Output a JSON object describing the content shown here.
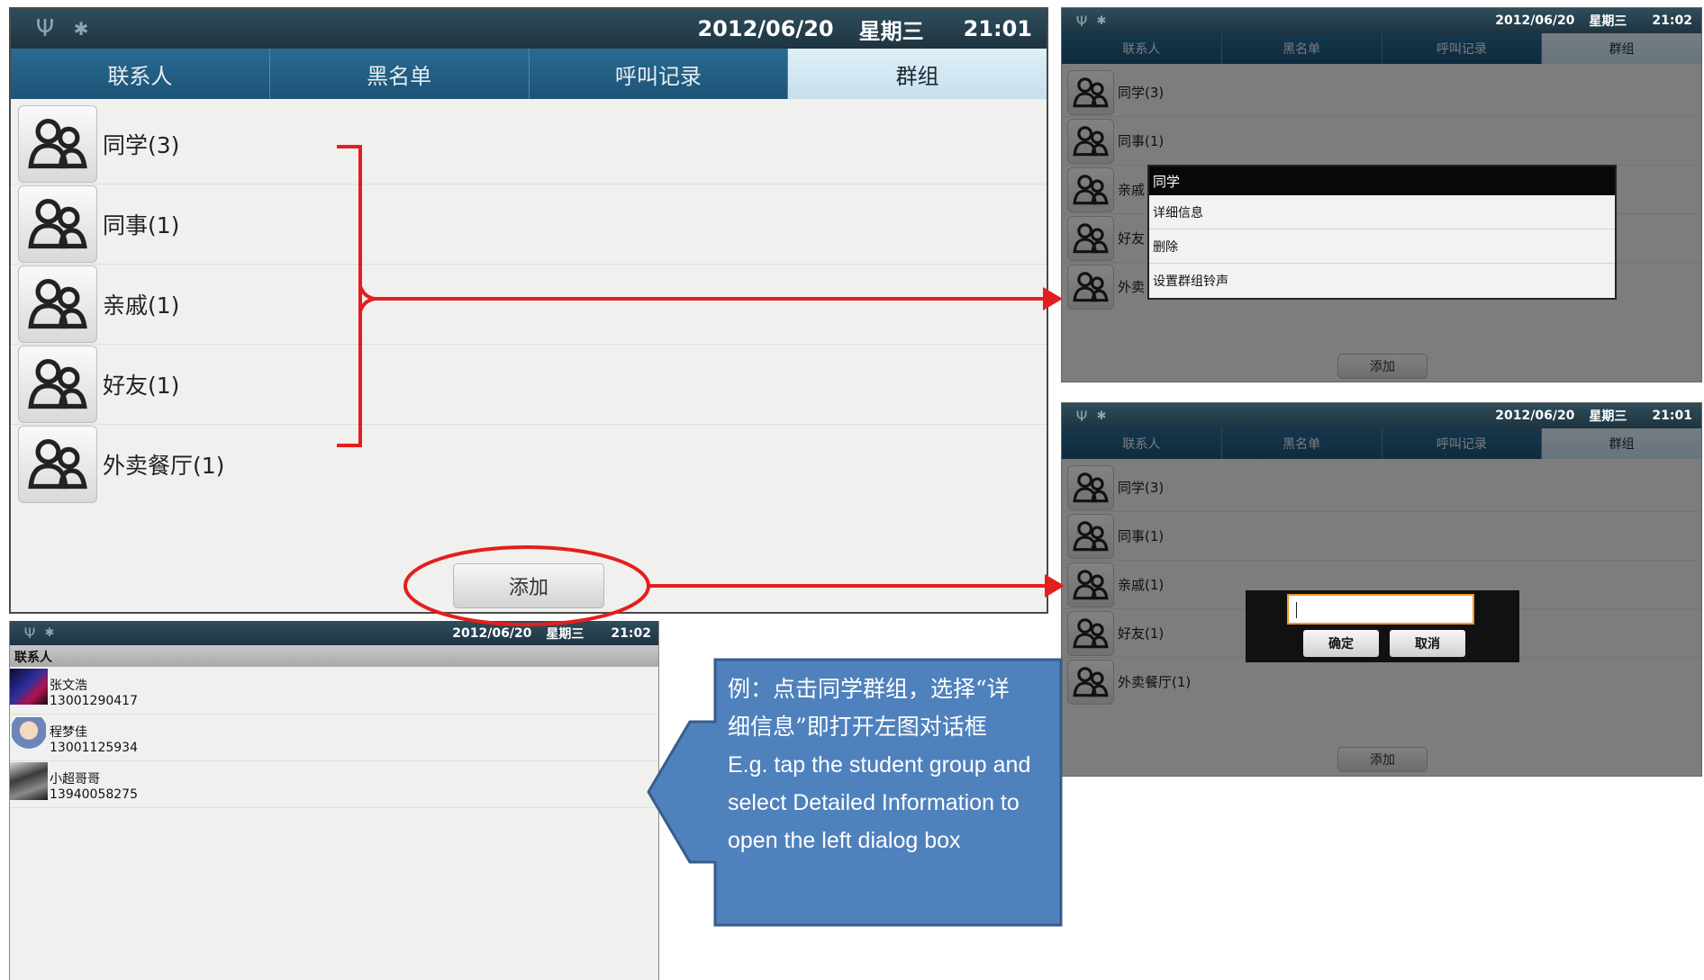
{
  "status": {
    "date": "2012/06/20",
    "weekday": "星期三",
    "time_main": "21:01",
    "time_menu": "21:02",
    "time_dialog": "21:01",
    "time_contacts": "21:02",
    "usb_icon": "usb-icon",
    "debug_icon": "android-debug-icon"
  },
  "tabs": [
    "联系人",
    "黑名单",
    "呼叫记录",
    "群组"
  ],
  "groups": [
    {
      "label": "同学(3)",
      "short": "同学(3)"
    },
    {
      "label": "同事(1)",
      "short": "同事(1)"
    },
    {
      "label": "亲戚(1)",
      "short": "亲戚"
    },
    {
      "label": "好友(1)",
      "short": "好友"
    },
    {
      "label": "外卖餐厅(1)",
      "short": "外卖"
    }
  ],
  "dialog_groups": [
    "同学(3)",
    "同事(1)",
    "亲戚(1)",
    "好友(1)",
    "外卖餐厅(1)"
  ],
  "add_button": "添加",
  "context_menu": {
    "title": "同学",
    "items": [
      "详细信息",
      "删除",
      "设置群组铃声"
    ]
  },
  "input_dialog": {
    "value": "",
    "ok": "确定",
    "cancel": "取消"
  },
  "contacts_screen": {
    "header": "联系人",
    "contacts": [
      {
        "name": "张文浩",
        "phone": "13001290417"
      },
      {
        "name": "程梦佳",
        "phone": "13001125934"
      },
      {
        "name": "小超哥哥",
        "phone": "13940058275"
      }
    ]
  },
  "callout": {
    "lines": [
      "例：点击同学群组，选择“详",
      "细信息”即打开左图对话框",
      "E.g. tap the student group and",
      "select Detailed Information to",
      "open the left dialog box"
    ]
  },
  "colors": {
    "annotation_red": "#e41e1e",
    "callout_fill": "#4f81bd",
    "callout_border": "#385d8a",
    "tab_blue": "#1c5376",
    "tab_active": "#d3e7f1",
    "input_focus": "#f29a1d"
  }
}
